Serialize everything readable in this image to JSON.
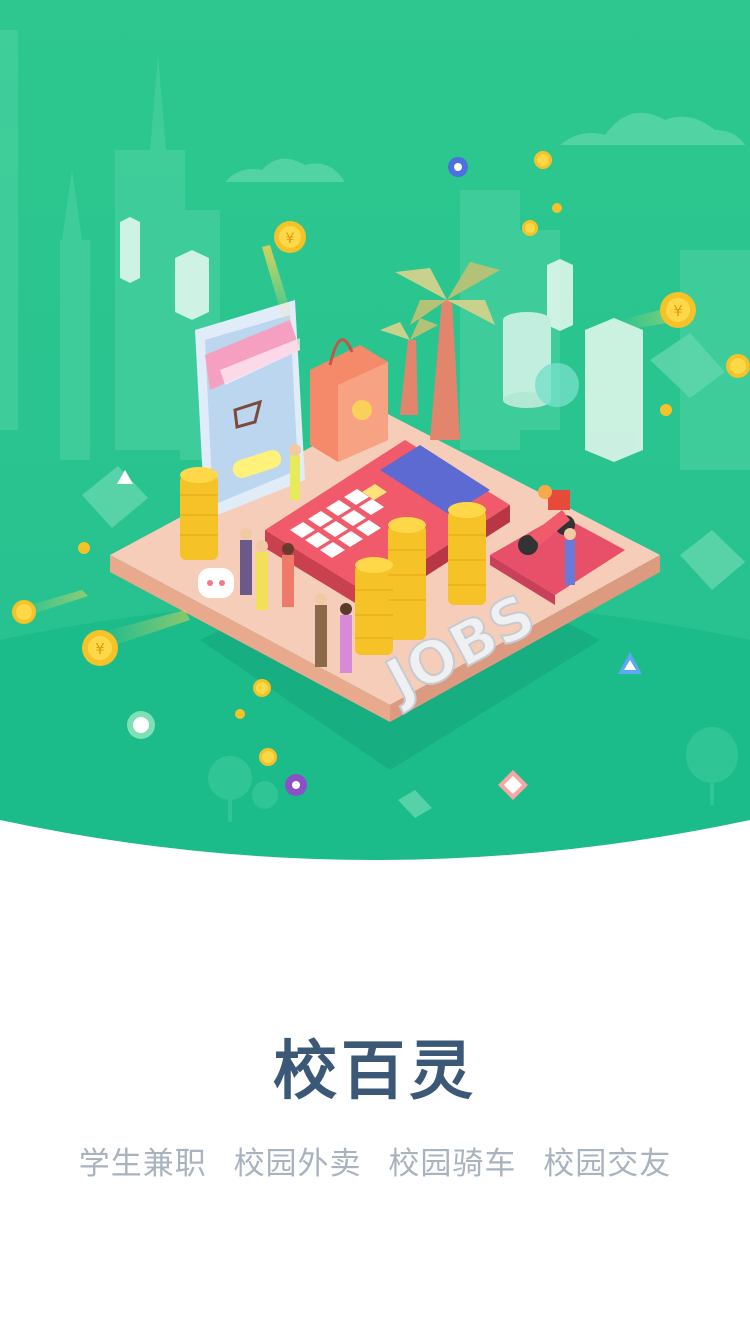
{
  "app": {
    "title": "校百灵",
    "tags": [
      "学生兼职",
      "校园外卖",
      "校园骑车",
      "校园交友"
    ]
  },
  "illustration": {
    "jobs_word": "JOBS",
    "coin_symbol": "¥",
    "colors": {
      "sky_green": "#2ec48f",
      "ground_green": "#14b98a",
      "platform": "#f6cdb8",
      "calculator": "#f05a6a",
      "coin": "#f5c227",
      "title_text": "#3b5877",
      "tag_text": "#a9b3bf"
    }
  }
}
